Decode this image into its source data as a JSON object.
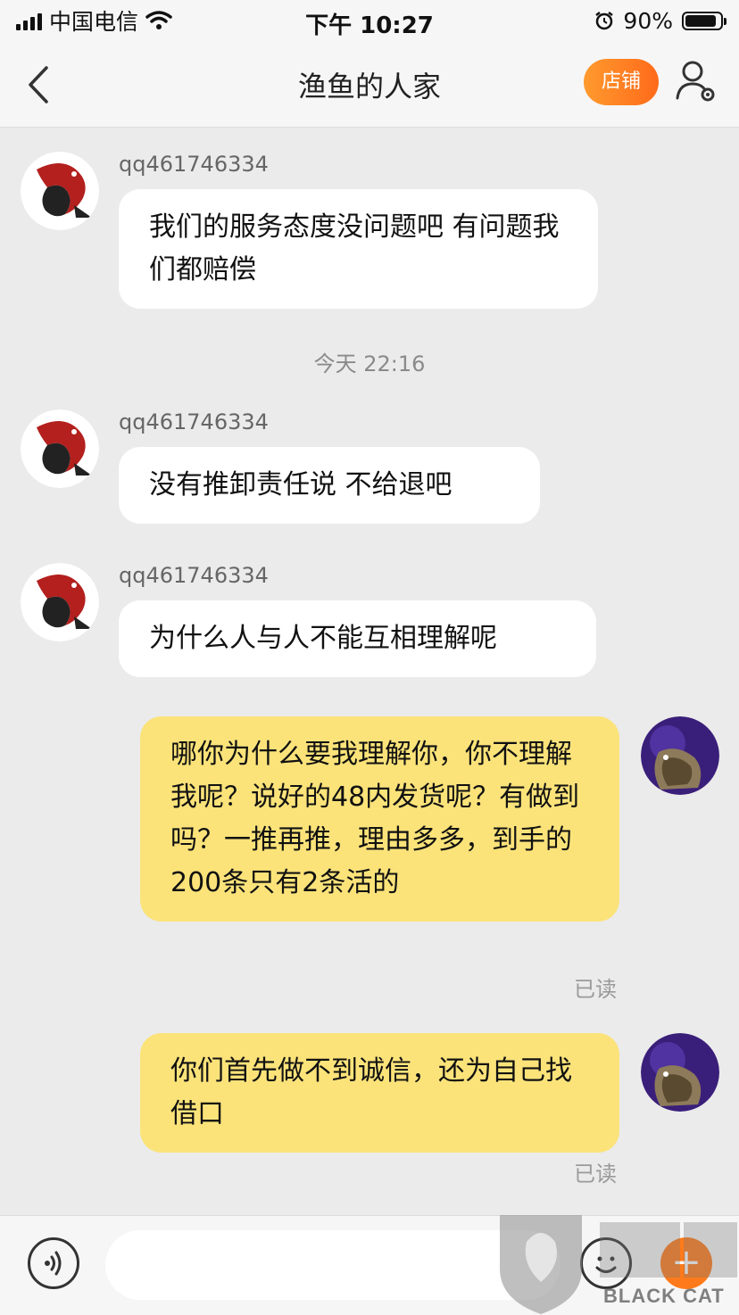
{
  "status_bar": {
    "carrier": "中国电信",
    "time": "下午 10:27",
    "battery": "90%",
    "battery_level": 0.9
  },
  "header": {
    "title": "渔鱼的人家",
    "shop_label": "店铺"
  },
  "messages": [
    {
      "sender": "qq461746334",
      "text": "我们的服务态度没问题吧   有问题我们都赔偿"
    },
    {
      "timestamp": "今天 22:16"
    },
    {
      "sender": "qq461746334",
      "text": "没有推卸责任说 不给退吧"
    },
    {
      "sender": "qq461746334",
      "text": "为什么人与人不能互相理解呢"
    },
    {
      "text": "哪你为什么要我理解你，你不理解我呢？说好的48内发货呢？有做到吗？一推再推，理由多多，到手的200条只有2条活的",
      "status": "已读"
    },
    {
      "text": "你们首先做不到诚信，还为自己找借口",
      "status": "已读"
    }
  ],
  "input": {
    "value": ""
  },
  "watermark": {
    "text": "BLACK CAT"
  },
  "colors": {
    "accent": "#ff7a1a",
    "own_bubble": "#fbe37a",
    "other_bubble": "#ffffff"
  }
}
